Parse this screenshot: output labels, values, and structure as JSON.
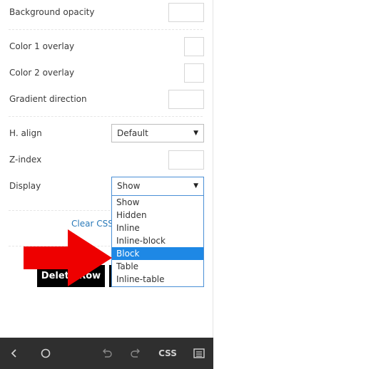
{
  "fields": {
    "background_opacity": "Background opacity",
    "color1_overlay": "Color 1 overlay",
    "color2_overlay": "Color 2 overlay",
    "gradient_direction": "Gradient direction",
    "h_align": "H. align",
    "h_align_value": "Default",
    "z_index": "Z-index",
    "display": "Display",
    "display_value": "Show"
  },
  "display_options": [
    "Show",
    "Hidden",
    "Inline",
    "Inline-block",
    "Block",
    "Table",
    "Inline-table"
  ],
  "highlighted_option": "Block",
  "clear_css": "Clear CSS",
  "delete_row": "Delete Row",
  "bottom_bar": {
    "css_label": "CSS",
    "icons": [
      "chevron-left-icon",
      "circle-icon",
      "undo-icon",
      "redo-icon",
      "css-label",
      "list-icon"
    ]
  },
  "colors": {
    "accent_blue": "#1e88e5",
    "arrow_red": "#ee0000",
    "link_blue": "#2a7ab9",
    "bottom_bar": "#2f2f2f"
  }
}
